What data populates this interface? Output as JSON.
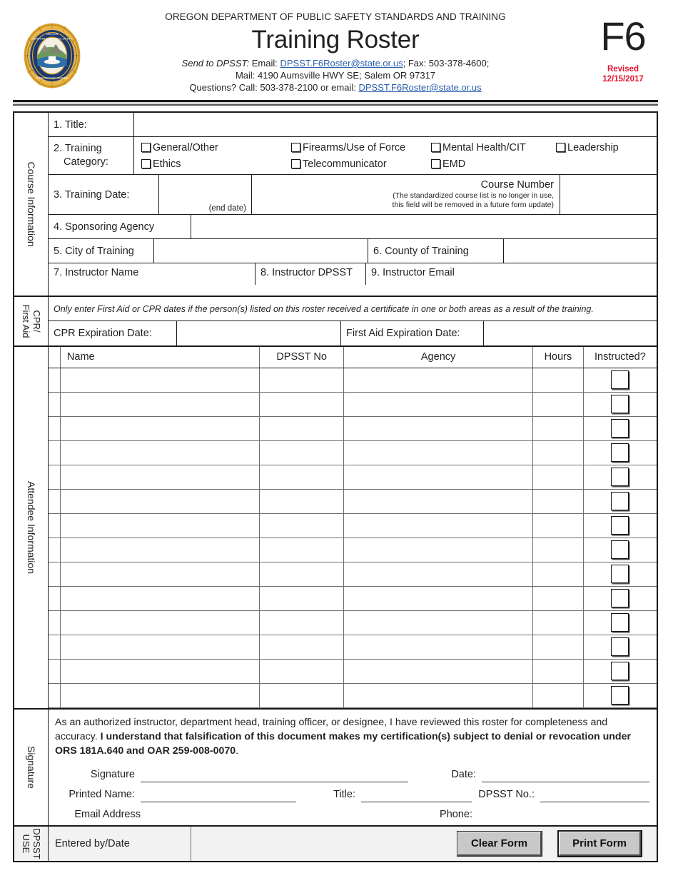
{
  "header": {
    "agency": "OREGON DEPARTMENT OF PUBLIC SAFETY STANDARDS AND TRAINING",
    "title": "Training Roster",
    "send_prefix": "Send to DPSST:",
    "send_email_label": "Email:",
    "send_email": "DPSST.F6Roster@state.or.us",
    "send_fax": "; Fax: 503-378-4600;",
    "mail_line": "Mail: 4190 Aumsville HWY SE; Salem OR 97317",
    "questions_prefix": "Questions?",
    "questions_call": "Call: 503-378-2100 or email:",
    "questions_email": "DPSST.F6Roster@state.or.us",
    "form_code": "F6",
    "revised_label": "Revised",
    "revised_date": "12/15/2017",
    "seal_alt": "oregon-dpsst-seal",
    "link_color": "#2a5db0",
    "revised_color": "#e8112d"
  },
  "course": {
    "sidebar_label": "Course Information",
    "title_label": "1. Title:",
    "title_value": "",
    "category_label_line1": "2.  Training",
    "category_label_line2": "Category:",
    "categories_row1": [
      "General/Other",
      "Firearms/Use of Force",
      "Mental Health/CIT",
      "Leadership"
    ],
    "categories_row2": [
      "Ethics",
      "Telecommunicator",
      "EMD"
    ],
    "training_date_label": "3. Training Date:",
    "training_date_value": "",
    "end_date_hint": "(end date)",
    "end_date_value": "",
    "course_number_label": "Course Number",
    "course_number_note_1": "(The standardized course list is no longer in use,",
    "course_number_note_2": "this field will be removed in a future form update)",
    "course_number_value": "",
    "sponsoring_label": "4. Sponsoring Agency",
    "sponsoring_value": "",
    "city_label": "5. City of Training",
    "city_value": "",
    "county_label": "6. County of Training",
    "county_value": "",
    "instructor_name_label": "7. Instructor Name",
    "instructor_name_value": "",
    "instructor_dpsst_label": "8. Instructor DPSST",
    "instructor_dpsst_value": "",
    "instructor_email_label": "9. Instructor Email",
    "instructor_email_value": ""
  },
  "cpr": {
    "sidebar_label_line1": "CPR/",
    "sidebar_label_line2": "First Aid",
    "note": "Only enter First Aid or CPR dates if the person(s) listed on this roster received a certificate in one or both areas as a result of the training.",
    "cpr_label": "CPR Expiration Date:",
    "cpr_value": "",
    "first_aid_label": "First Aid Expiration Date:",
    "first_aid_value": ""
  },
  "attendee": {
    "sidebar_label": "Attendee Information",
    "columns": [
      "Name",
      "DPSST No",
      "Agency",
      "Hours",
      "Instructed?"
    ],
    "row_count": 14,
    "rows": [
      {
        "name": "",
        "dpsst_no": "",
        "agency": "",
        "hours": "",
        "instructed": false
      },
      {
        "name": "",
        "dpsst_no": "",
        "agency": "",
        "hours": "",
        "instructed": false
      },
      {
        "name": "",
        "dpsst_no": "",
        "agency": "",
        "hours": "",
        "instructed": false
      },
      {
        "name": "",
        "dpsst_no": "",
        "agency": "",
        "hours": "",
        "instructed": false
      },
      {
        "name": "",
        "dpsst_no": "",
        "agency": "",
        "hours": "",
        "instructed": false
      },
      {
        "name": "",
        "dpsst_no": "",
        "agency": "",
        "hours": "",
        "instructed": false
      },
      {
        "name": "",
        "dpsst_no": "",
        "agency": "",
        "hours": "",
        "instructed": false
      },
      {
        "name": "",
        "dpsst_no": "",
        "agency": "",
        "hours": "",
        "instructed": false
      },
      {
        "name": "",
        "dpsst_no": "",
        "agency": "",
        "hours": "",
        "instructed": false
      },
      {
        "name": "",
        "dpsst_no": "",
        "agency": "",
        "hours": "",
        "instructed": false
      },
      {
        "name": "",
        "dpsst_no": "",
        "agency": "",
        "hours": "",
        "instructed": false
      },
      {
        "name": "",
        "dpsst_no": "",
        "agency": "",
        "hours": "",
        "instructed": false
      },
      {
        "name": "",
        "dpsst_no": "",
        "agency": "",
        "hours": "",
        "instructed": false
      },
      {
        "name": "",
        "dpsst_no": "",
        "agency": "",
        "hours": "",
        "instructed": false
      }
    ]
  },
  "signature": {
    "sidebar_label": "Signature",
    "para_plain_1": "As an authorized instructor, department head, training officer, or designee, I have reviewed this roster for completeness and accuracy.  ",
    "para_bold": "I understand that falsification of this document makes my certification(s) subject to denial or revocation under ORS 181A.640 and OAR 259-008-0070",
    "para_plain_2": ".",
    "signature_label": "Signature",
    "signature_value": "",
    "date_label": "Date:",
    "date_value": "",
    "printed_name_label": "Printed Name:",
    "printed_name_value": "",
    "title_label": "Title:",
    "title_value": "",
    "dpsst_no_label": "DPSST No.:",
    "dpsst_no_value": "",
    "email_label": "Email Address",
    "email_value": "",
    "phone_label": "Phone:",
    "phone_value": ""
  },
  "dpsst_use": {
    "sidebar_label_line1": "DPSST",
    "sidebar_label_line2": "USE",
    "entered_by_label": "Entered by/Date",
    "entered_by_value": "",
    "clear_button": "Clear Form",
    "print_button": "Print Form"
  }
}
